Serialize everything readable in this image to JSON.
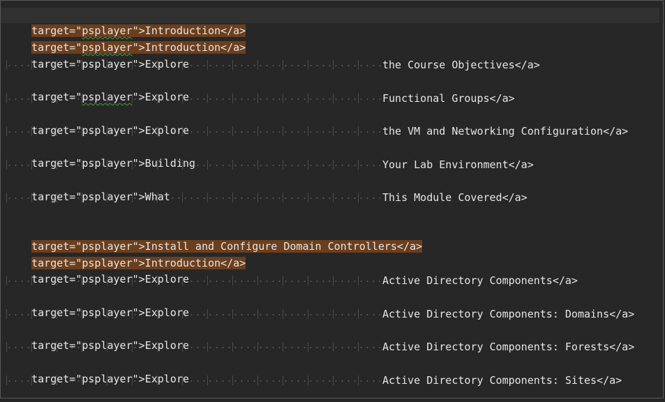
{
  "editor": {
    "lines": {
      "l1": {
        "attr": "target=\"",
        "sq": "psplayer",
        "rest": "\">Introduction</a>"
      },
      "l2": {
        "attr": "target=\"",
        "sq": "psplayer",
        "rest": "\">Introduction</a>"
      },
      "l3": {
        "text": "target=\"psplayer\">Explore",
        "cont": "the Course Objectives</a>"
      },
      "l4": {
        "attr": "target=\"",
        "sq": "psplayer",
        "rest": "\">Explore",
        "cont": "Functional Groups</a>"
      },
      "l5": {
        "text": "target=\"psplayer\">Explore",
        "cont": "the VM and Networking Configuration</a>"
      },
      "l6": {
        "text": "target=\"psplayer\">Building",
        "cont": "Your Lab Environment</a>"
      },
      "l7": {
        "text": "target=\"psplayer\">What",
        "cont": "This Module Covered</a>"
      },
      "l8": {
        "text": "target=\"psplayer\">Install and Configure Domain Controllers</a>"
      },
      "l9": {
        "text": "target=\"psplayer\">Introduction</a>"
      },
      "l10": {
        "text": "target=\"psplayer\">Explore",
        "cont": "Active Directory Components</a>"
      },
      "l11": {
        "text": "target=\"psplayer\">Explore",
        "cont": "Active Directory Components: Domains</a>"
      },
      "l12": {
        "text": "target=\"psplayer\">Explore",
        "cont": "Active Directory Components: Forests</a>"
      },
      "l13": {
        "text": "target=\"psplayer\">Explore",
        "cont": "Active Directory Components: Sites</a>"
      }
    }
  },
  "colors": {
    "background": "#272727",
    "text": "#e6e6e6",
    "selection_highlight": "#6b3f1e",
    "spellcheck_squiggle": "#3fa33f",
    "indent_guides": "#5c5c5c"
  }
}
